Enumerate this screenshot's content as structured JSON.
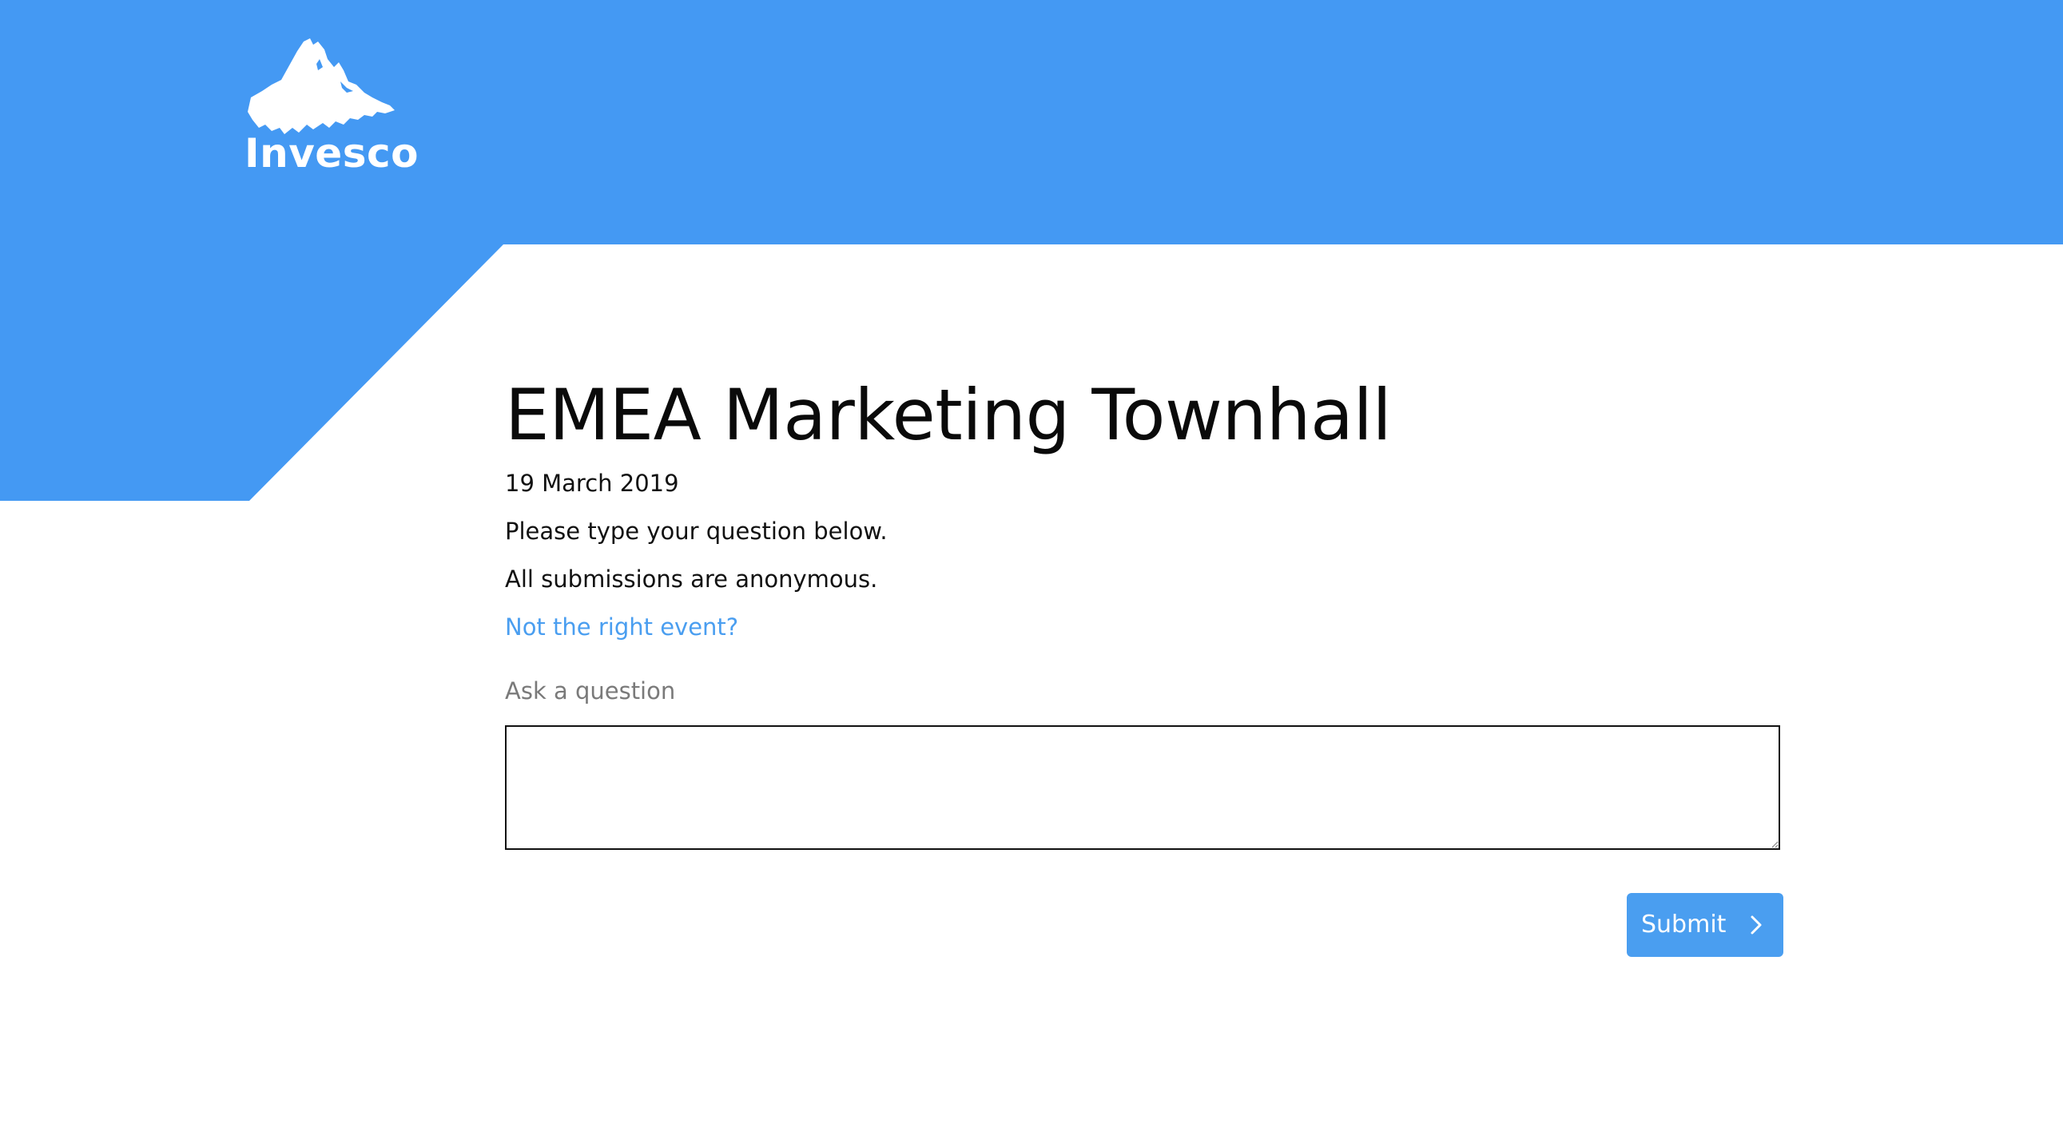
{
  "brand": {
    "name": "Invesco",
    "logo_icon": "mountain-logo-icon",
    "banner_color": "#4499f3"
  },
  "event": {
    "title": "EMEA Marketing Townhall",
    "date": "19 March 2019",
    "instructions": "Please type your question below.",
    "anonymity_note": "All submissions are anonymous.",
    "wrong_event_link": "Not the right event?"
  },
  "form": {
    "question_label": "Ask a question",
    "question_value": "",
    "submit_label": "Submit",
    "submit_icon": "chevron-right-icon",
    "accent_color": "#4a9ef0"
  }
}
